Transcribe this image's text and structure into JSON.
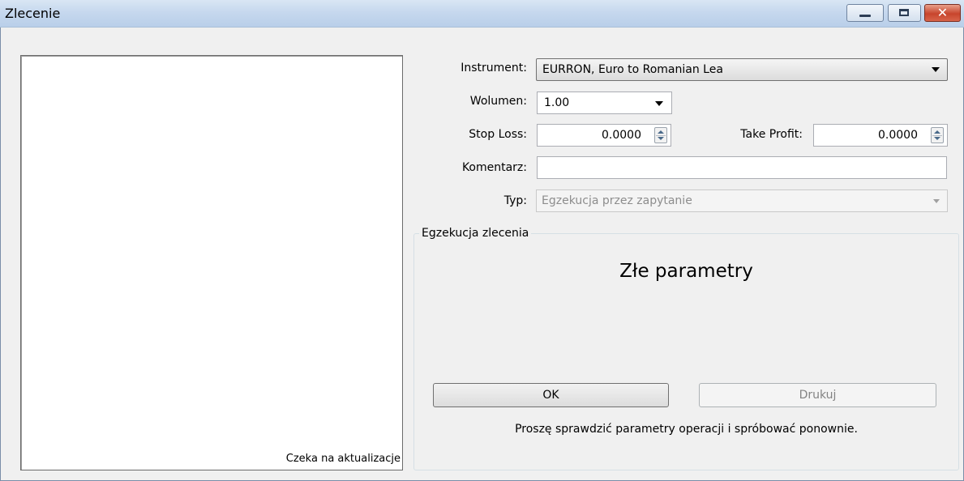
{
  "window": {
    "title": "Zlecenie",
    "controls": {
      "minimize": "minimize",
      "maximize": "maximize",
      "close": "close"
    }
  },
  "left_panel": {
    "status": "Czeka na aktualizacje"
  },
  "form": {
    "instrument": {
      "label": "Instrument:",
      "value": "EURRON, Euro to Romanian Lea"
    },
    "volume": {
      "label": "Wolumen:",
      "value": "1.00"
    },
    "stop_loss": {
      "label": "Stop Loss:",
      "value": "0.0000"
    },
    "take_profit": {
      "label": "Take Profit:",
      "value": "0.0000"
    },
    "comment": {
      "label": "Komentarz:",
      "value": ""
    },
    "type": {
      "label": "Typ:",
      "value": "Egzekucja przez zapytanie"
    }
  },
  "execution": {
    "group_label": "Egzekucja zlecenia",
    "message": "Złe parametry",
    "ok_label": "OK",
    "print_label": "Drukuj",
    "hint": "Proszę sprawdzić parametry operacji i spróbować ponownie."
  }
}
